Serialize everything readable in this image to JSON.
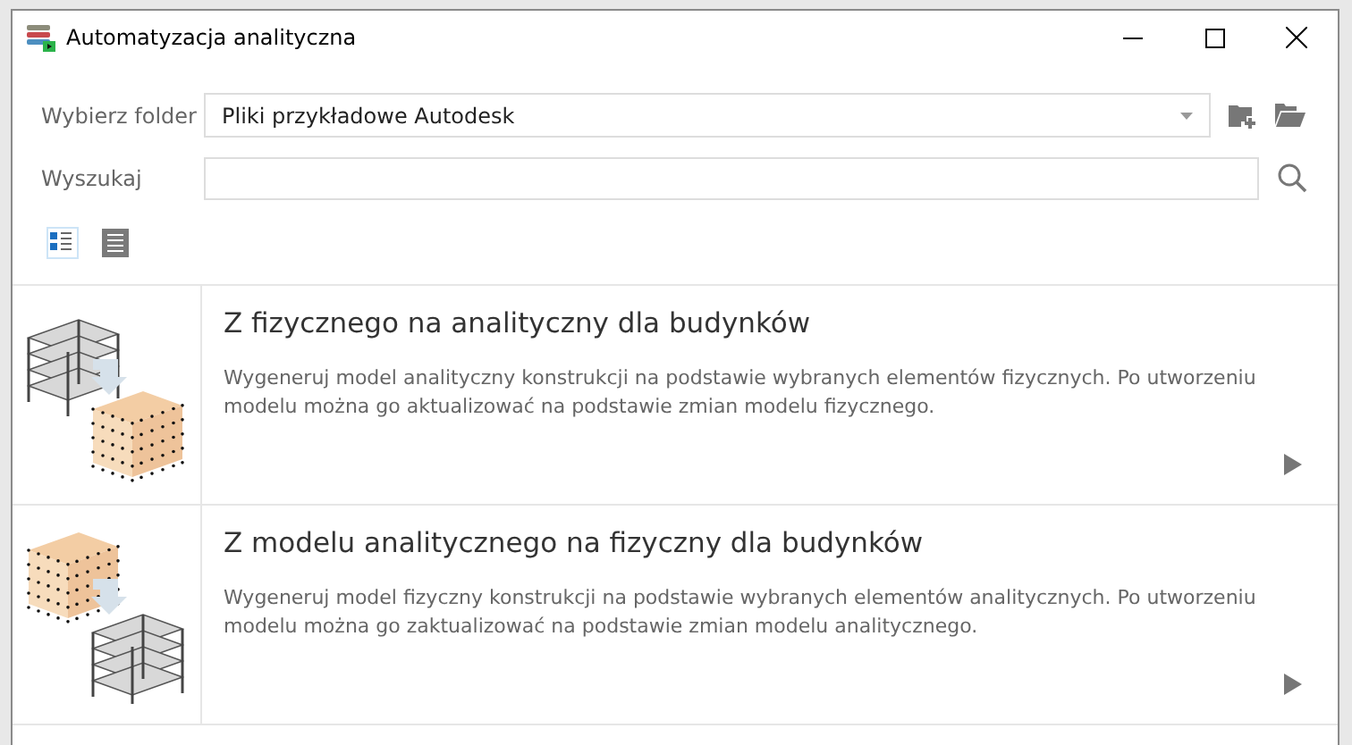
{
  "window": {
    "title": "Automatyzacja analityczna"
  },
  "folder": {
    "label": "Wybierz folder",
    "value": "Pliki przykładowe Autodesk"
  },
  "search": {
    "label": "Wyszukaj"
  },
  "view_modes": [
    {
      "kind": "tiles",
      "selected": true
    },
    {
      "kind": "list",
      "selected": false
    }
  ],
  "items": [
    {
      "kind": "to-analytical",
      "title": "Z fizycznego na analityczny dla budynków",
      "description": "Wygeneruj model analityczny konstrukcji na podstawie wybranych elementów fizycznych. Po utworzeniu modelu można go aktualizować na podstawie zmian modelu fizycznego."
    },
    {
      "kind": "to-physical",
      "title": "Z modelu analitycznego na fizyczny dla budynków",
      "description": "Wygeneruj model fizyczny konstrukcji na podstawie wybranych elementów analitycznych. Po utworzeniu modelu można go zaktualizować na podstawie zmian modelu analitycznego."
    }
  ]
}
